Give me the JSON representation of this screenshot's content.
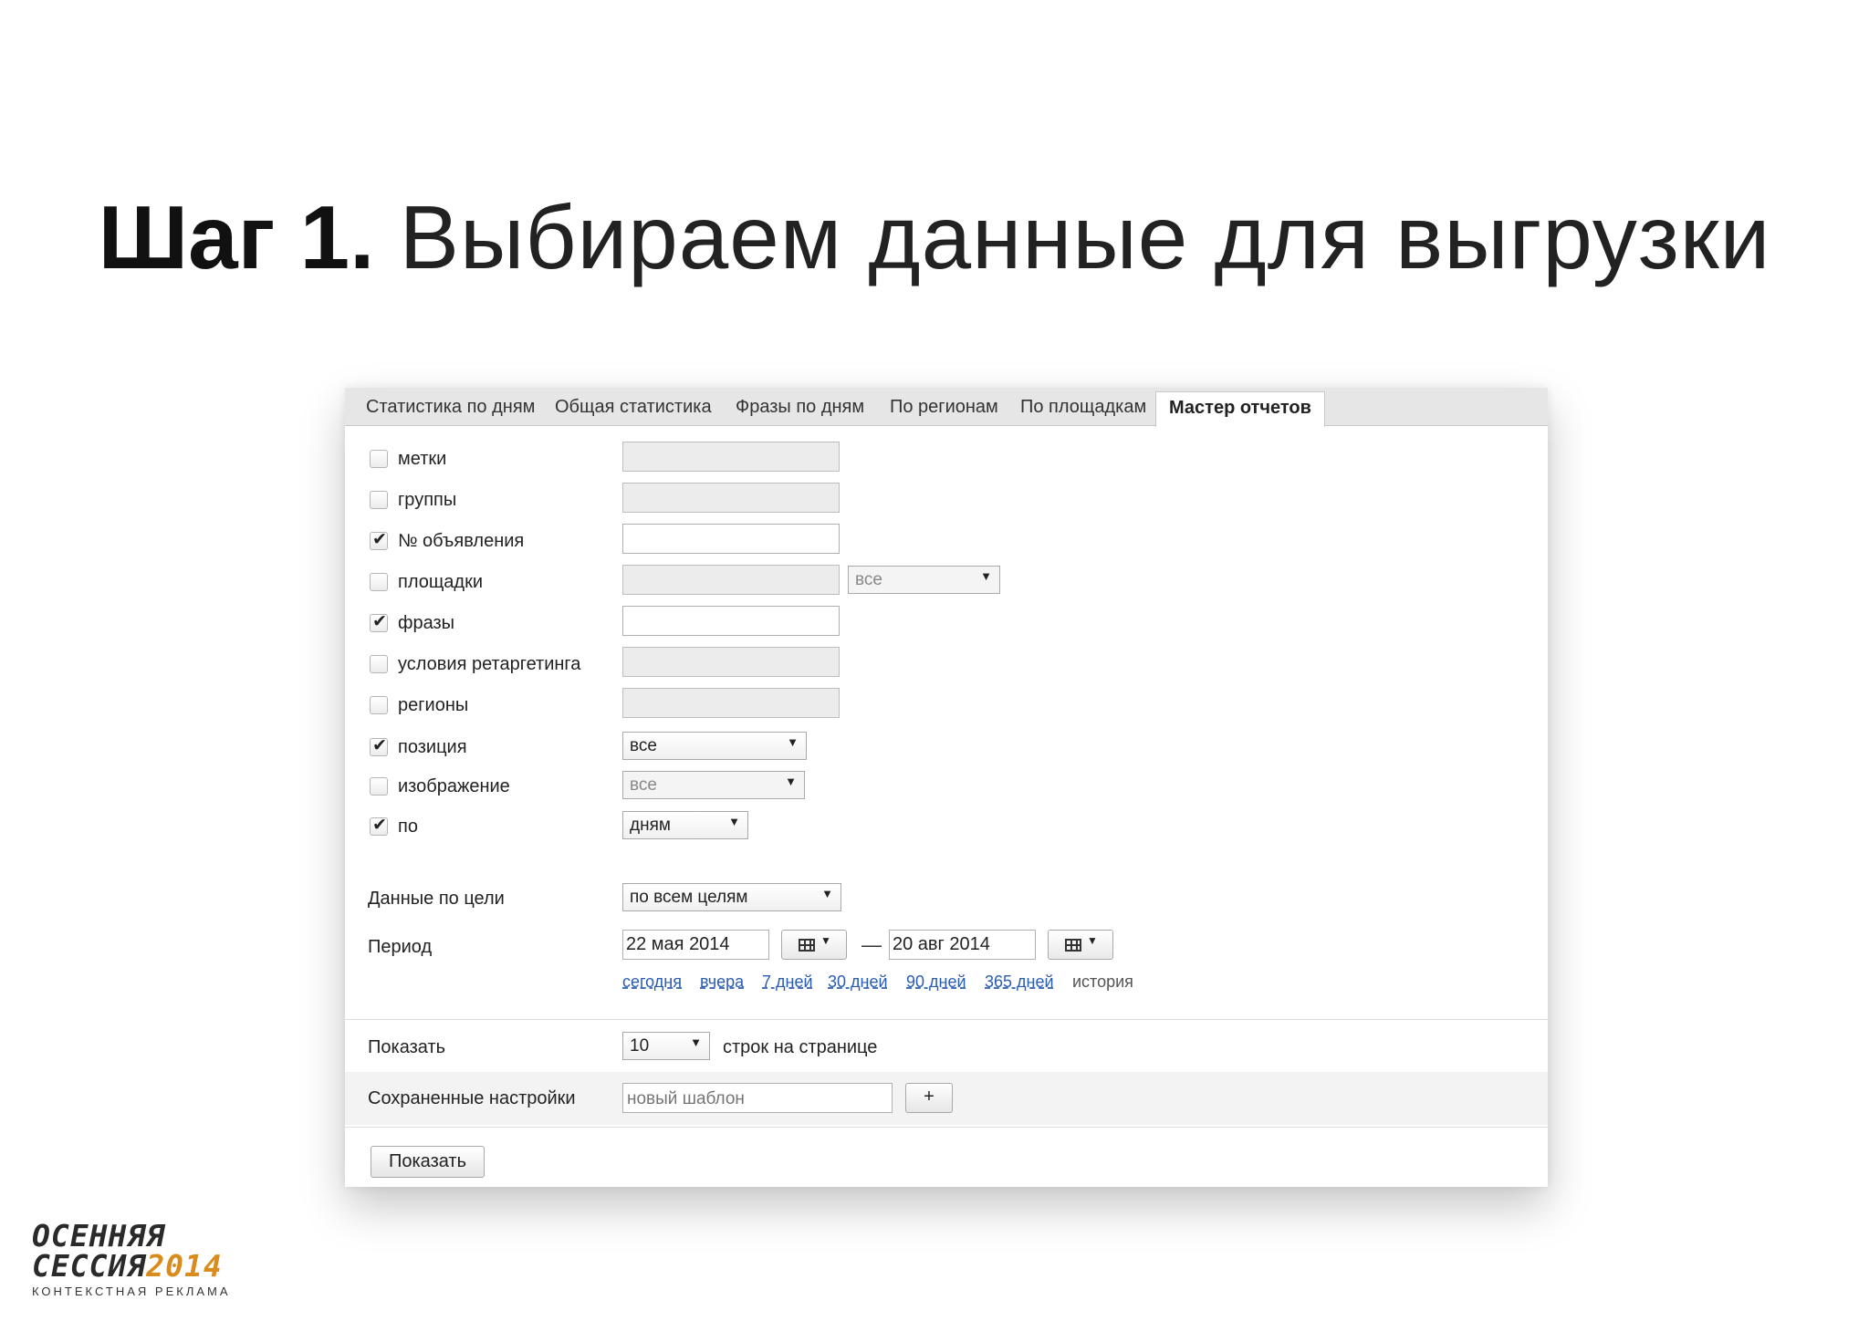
{
  "slide": {
    "title_bold": "Шаг 1.",
    "title_rest": "Выбираем данные для выгрузки"
  },
  "tabs": [
    {
      "label": "Статистика по дням",
      "active": false
    },
    {
      "label": "Общая статистика",
      "active": false
    },
    {
      "label": "Фразы по дням",
      "active": false
    },
    {
      "label": "По регионам",
      "active": false
    },
    {
      "label": "По площадкам",
      "active": false
    },
    {
      "label": "Мастер отчетов",
      "active": true
    }
  ],
  "filters": [
    {
      "label": "метки",
      "checked": false
    },
    {
      "label": "группы",
      "checked": false
    },
    {
      "label": "№ объявления",
      "checked": true
    },
    {
      "label": "площадки",
      "checked": false,
      "select_value": "все"
    },
    {
      "label": "фразы",
      "checked": true
    },
    {
      "label": "условия ретаргетинга",
      "checked": false
    },
    {
      "label": "регионы",
      "checked": false
    },
    {
      "label": "позиция",
      "checked": true,
      "select_value": "все"
    },
    {
      "label": "изображение",
      "checked": false,
      "select_value": "все"
    },
    {
      "label": "по",
      "checked": true,
      "select_value": "дням"
    }
  ],
  "goals": {
    "label": "Данные по цели",
    "value": "по всем целям"
  },
  "period": {
    "label": "Период",
    "from": "22 мая 2014",
    "separator": "—",
    "to": "20 авг 2014",
    "quick_links": [
      "сегодня",
      "вчера",
      "7 дней",
      "30 дней",
      "90 дней",
      "365 дней"
    ],
    "history": "история"
  },
  "show": {
    "label": "Показать",
    "value": "10",
    "suffix": "строк на странице"
  },
  "saved": {
    "label": "Сохраненные настройки",
    "placeholder": "новый шаблон",
    "add_label": "+"
  },
  "submit_label": "Показать",
  "checkmark": "✔",
  "arrow": "▼",
  "logo": {
    "line1": "ОСЕННЯЯ",
    "line2": "СЕССИЯ",
    "year": "2014",
    "line3": "КОНТЕКСТНАЯ РЕКЛАМА"
  }
}
